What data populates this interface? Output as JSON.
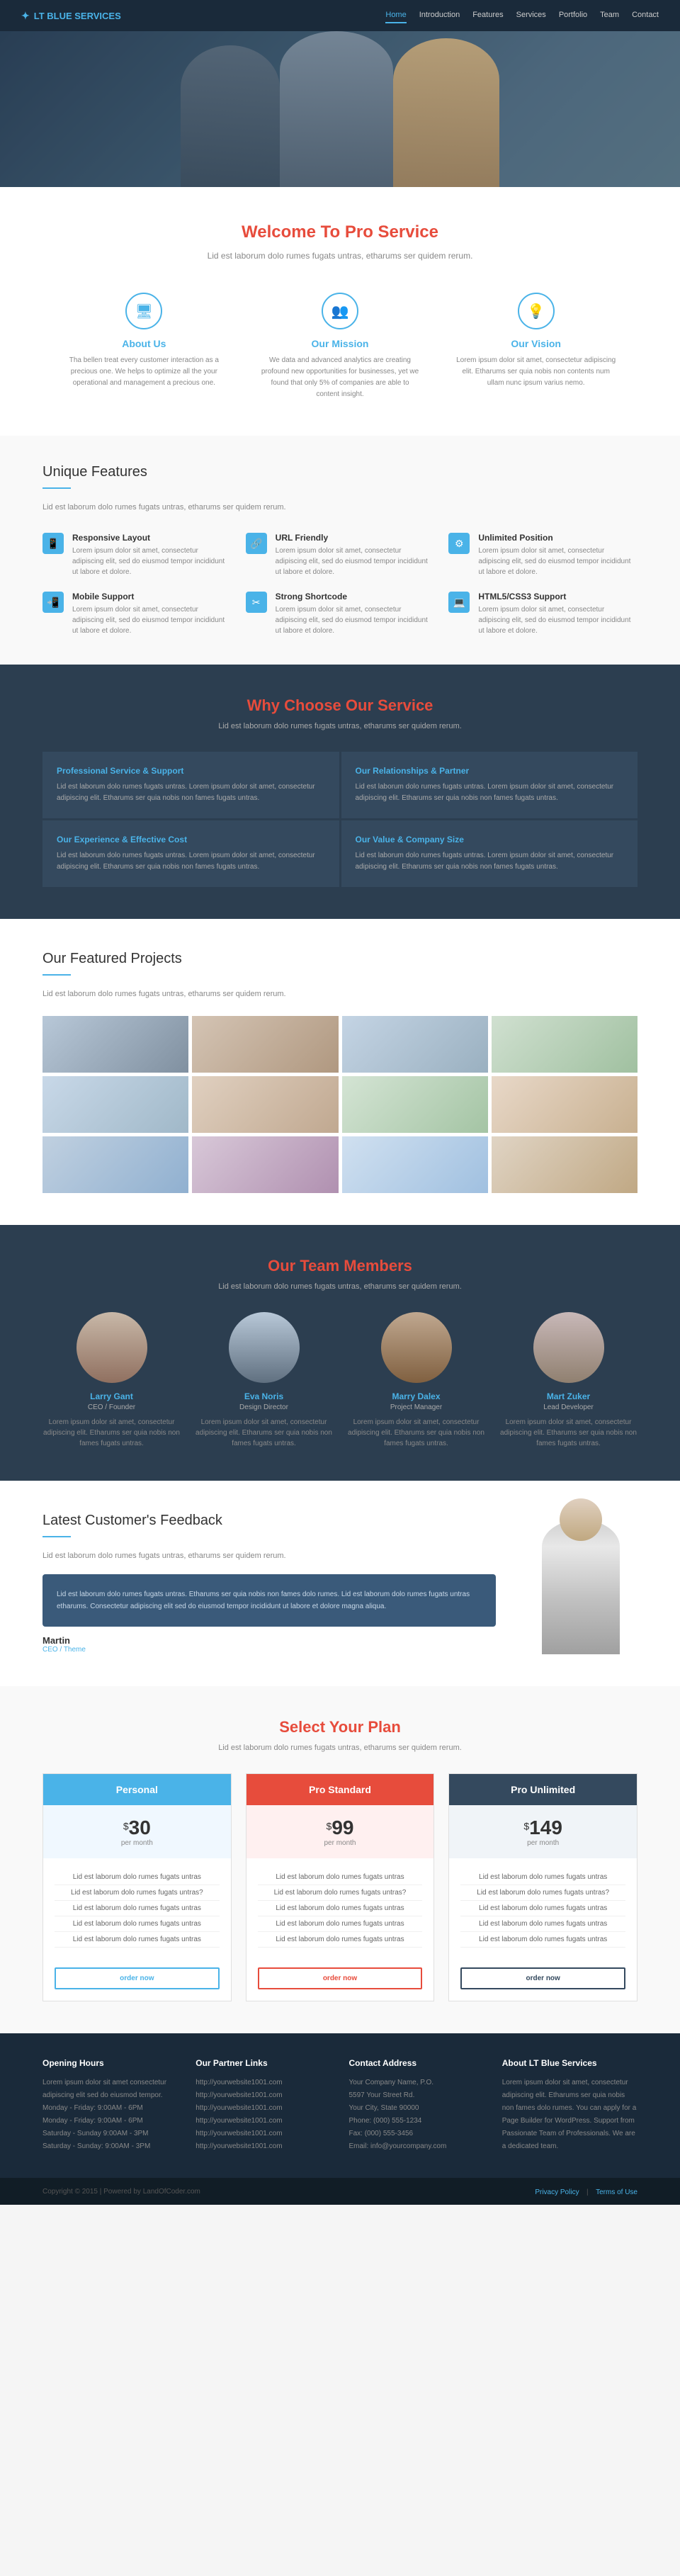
{
  "brand": {
    "name": "LT BLUE SERVICES",
    "icon": "✦"
  },
  "nav": {
    "links": [
      "Home",
      "Introduction",
      "Features",
      "Services",
      "Portfolio",
      "Team",
      "Contact"
    ],
    "active": "Home"
  },
  "welcome": {
    "title_prefix": "Welcome To ",
    "title_highlight": "Pro Service",
    "subtitle": "Lid est laborum dolo rumes fugats untras, etharums ser quidem rerum.",
    "cards": [
      {
        "icon": "🖥",
        "title": "About Us",
        "text": "Tha bellen treat every customer interaction as a precious one. We helps to optimize all the your operational and management a precious one."
      },
      {
        "icon": "👥",
        "title": "Our Mission",
        "text": "We data and advanced analytics are creating profound new opportunities for businesses, yet we found that only 5% of companies are able to content insight."
      },
      {
        "icon": "💡",
        "title": "Our Vision",
        "text": "Lorem ipsum dolor sit amet, consectetur adipiscing elit. Etharums ser quia nobis non contents num ullam nunc ipsum varius nemo."
      }
    ]
  },
  "features": {
    "title": "Unique Features",
    "subtitle": "Lid est laborum dolo rumes fugats untras, etharums ser quidem rerum.",
    "items": [
      {
        "icon": "📱",
        "title": "Responsive Layout",
        "text": "Lorem ipsum dolor sit amet, consectetur adipiscing elit, sed do eiusmod tempor incididunt ut labore et dolore."
      },
      {
        "icon": "🔗",
        "title": "URL Friendly",
        "text": "Lorem ipsum dolor sit amet, consectetur adipiscing elit, sed do eiusmod tempor incididunt ut labore et dolore."
      },
      {
        "icon": "⚙",
        "title": "Unlimited Position",
        "text": "Lorem ipsum dolor sit amet, consectetur adipiscing elit, sed do eiusmod tempor incididunt ut labore et dolore."
      },
      {
        "icon": "📲",
        "title": "Mobile Support",
        "text": "Lorem ipsum dolor sit amet, consectetur adipiscing elit, sed do eiusmod tempor incididunt ut labore et dolore."
      },
      {
        "icon": "✂",
        "title": "Strong Shortcode",
        "text": "Lorem ipsum dolor sit amet, consectetur adipiscing elit, sed do eiusmod tempor incididunt ut labore et dolore."
      },
      {
        "icon": "💻",
        "title": "HTML5/CSS3 Support",
        "text": "Lorem ipsum dolor sit amet, consectetur adipiscing elit, sed do eiusmod tempor incididunt ut labore et dolore."
      }
    ]
  },
  "why": {
    "title_prefix": "Why Choose ",
    "title_highlight": "Our Service",
    "subtitle": "Lid est laborum dolo rumes fugats untras, etharums ser quidem rerum.",
    "cards": [
      {
        "title": "Professional Service & Support",
        "text": "Lid est laborum dolo rumes fugats untras. Lorem ipsum dolor sit amet, consectetur adipiscing elit. Etharums ser quia nobis non fames fugats untras."
      },
      {
        "title": "Our Relationships & Partner",
        "text": "Lid est laborum dolo rumes fugats untras. Lorem ipsum dolor sit amet, consectetur adipiscing elit. Etharums ser quia nobis non fames fugats untras."
      },
      {
        "title": "Our Experience & Effective Cost",
        "text": "Lid est laborum dolo rumes fugats untras. Lorem ipsum dolor sit amet, consectetur adipiscing elit. Etharums ser quia nobis non fames fugats untras."
      },
      {
        "title": "Our Value & Company Size",
        "text": "Lid est laborum dolo rumes fugats untras. Lorem ipsum dolor sit amet, consectetur adipiscing elit. Etharums ser quia nobis non fames fugats untras."
      }
    ]
  },
  "projects": {
    "title": "Our Featured Projects",
    "subtitle": "Lid est laborum dolo rumes fugats untras, etharums ser quidem rerum.",
    "thumbs": [
      "pt1",
      "pt2",
      "pt3",
      "pt4",
      "pt5",
      "pt6",
      "pt7",
      "pt8",
      "pt9",
      "pt10",
      "pt11",
      "pt12"
    ]
  },
  "team": {
    "title_prefix": "Our Team ",
    "title_highlight": "Members",
    "subtitle": "Lid est laborum dolo rumes fugats untras, etharums ser quidem rerum.",
    "members": [
      {
        "name": "Larry Gant",
        "role": "CEO / Founder",
        "text": "Lorem ipsum dolor sit amet, consectetur adipiscing elit. Etharums ser quia nobis non fames fugats untras.",
        "av": "av1"
      },
      {
        "name": "Eva Noris",
        "role": "Design Director",
        "text": "Lorem ipsum dolor sit amet, consectetur adipiscing elit. Etharums ser quia nobis non fames fugats untras.",
        "av": "av2"
      },
      {
        "name": "Marry Dalex",
        "role": "Project Manager",
        "text": "Lorem ipsum dolor sit amet, consectetur adipiscing elit. Etharums ser quia nobis non fames fugats untras.",
        "av": "av3"
      },
      {
        "name": "Mart Zuker",
        "role": "Lead Developer",
        "text": "Lorem ipsum dolor sit amet, consectetur adipiscing elit. Etharums ser quia nobis non fames fugats untras.",
        "av": "av4"
      }
    ]
  },
  "feedback": {
    "title": "Latest Customer's Feedback",
    "subtitle": "Lid est laborum dolo rumes fugats untras, etharums ser quidem rerum.",
    "quote": "Lid est laborum dolo rumes fugats untras. Etharums ser quia nobis non fames dolo rumes. Lid est laborum dolo rumes fugats untras etharums. Consectetur adipiscing elit sed do eiusmod tempor incididunt ut labore et dolore magna aliqua.",
    "author": "Martin",
    "author_title": "CEO / Theme"
  },
  "pricing": {
    "title_prefix": "Select Your ",
    "title_highlight": "Plan",
    "subtitle": "Lid est laborum dolo rumes fugats untras, etharums ser quidem rerum.",
    "plans": [
      {
        "name": "Personal",
        "price": "30",
        "period": "per month",
        "header_class": "ph-blue",
        "features": [
          "Lid est laborum dolo rumes fugats untras",
          "Lid est laborum dolo rumes fugats untras?",
          "Lid est laborum dolo rumes fugats untras",
          "Lid est laborum dolo rumes fugats untras",
          "Lid est laborum dolo rumes fugats untras"
        ],
        "btn": "order now",
        "btn_class": "pricing-btn"
      },
      {
        "name": "Pro Standard",
        "price": "99",
        "period": "per month",
        "header_class": "ph-red",
        "features": [
          "Lid est laborum dolo rumes fugats untras",
          "Lid est laborum dolo rumes fugats untras?",
          "Lid est laborum dolo rumes fugats untras",
          "Lid est laborum dolo rumes fugats untras",
          "Lid est laborum dolo rumes fugats untras"
        ],
        "btn": "order now",
        "btn_class": "pricing-btn pricing-btn-red"
      },
      {
        "name": "Pro Unlimited",
        "price": "149",
        "period": "per month",
        "header_class": "ph-dark",
        "features": [
          "Lid est laborum dolo rumes fugats untras",
          "Lid est laborum dolo rumes fugats untras?",
          "Lid est laborum dolo rumes fugats untras",
          "Lid est laborum dolo rumes fugats untras",
          "Lid est laborum dolo rumes fugats untras"
        ],
        "btn": "order now",
        "btn_class": "pricing-btn pricing-btn-dark"
      }
    ]
  },
  "footer": {
    "cols": [
      {
        "title": "Opening Hours",
        "lines": [
          "Lorem ipsum dolor sit amet consectetur",
          "adipiscing elit sed do eiusmod tempor.",
          "Monday - Friday: 9:00AM - 6PM",
          "Monday - Friday: 9:00AM - 6PM",
          "Saturday - Sunday 9:00AM - 3PM",
          "Saturday - Sunday: 9:00AM - 3PM"
        ]
      },
      {
        "title": "Our Partner Links",
        "links": [
          "http://yourwebsite1001.com",
          "http://yourwebsite1001.com",
          "http://yourwebsite1001.com",
          "http://yourwebsite1001.com",
          "http://yourwebsite1001.com",
          "http://yourwebsite1001.com"
        ]
      },
      {
        "title": "Contact Address",
        "lines": [
          "Your Company Name, P.O.",
          "5597 Your Street Rd.",
          "Your City, State 90000",
          "Phone: (000) 555-1234",
          "Fax: (000) 555-3456",
          "Email: info@yourcompany.com"
        ]
      },
      {
        "title": "About LT Blue Services",
        "text": "Lorem ipsum dolor sit amet, consectetur adipiscing elit. Etharums ser quia nobis non fames dolo rumes. You can apply for a Page Builder for WordPress. Support from Passionate Team of Professionals. We are a dedicated team."
      }
    ],
    "bottom": {
      "copyright": "Copyright © 2015 | Powered by LandOfCoder.com",
      "links": [
        "Privacy Policy",
        "Terms of Use"
      ]
    }
  }
}
